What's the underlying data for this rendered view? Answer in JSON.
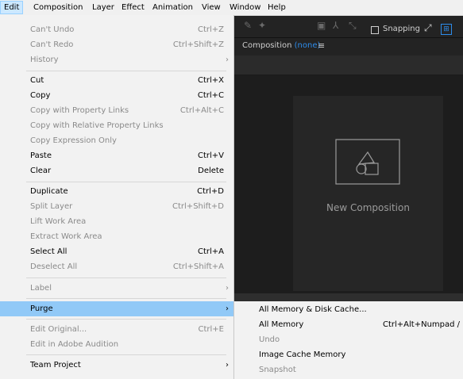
{
  "menubar": {
    "items": [
      "Edit",
      "Composition",
      "Layer",
      "Effect",
      "Animation",
      "View",
      "Window",
      "Help"
    ]
  },
  "edit_menu": {
    "undo": {
      "label": "Can't Undo",
      "shortcut": "Ctrl+Z"
    },
    "redo": {
      "label": "Can't Redo",
      "shortcut": "Ctrl+Shift+Z"
    },
    "history": {
      "label": "History"
    },
    "cut": {
      "label": "Cut",
      "shortcut": "Ctrl+X"
    },
    "copy": {
      "label": "Copy",
      "shortcut": "Ctrl+C"
    },
    "copy_prop_links": {
      "label": "Copy with Property Links",
      "shortcut": "Ctrl+Alt+C"
    },
    "copy_rel_prop_links": {
      "label": "Copy with Relative Property Links"
    },
    "copy_expr": {
      "label": "Copy Expression Only"
    },
    "paste": {
      "label": "Paste",
      "shortcut": "Ctrl+V"
    },
    "clear": {
      "label": "Clear",
      "shortcut": "Delete"
    },
    "duplicate": {
      "label": "Duplicate",
      "shortcut": "Ctrl+D"
    },
    "split_layer": {
      "label": "Split Layer",
      "shortcut": "Ctrl+Shift+D"
    },
    "lift_work_area": {
      "label": "Lift Work Area"
    },
    "extract_work_area": {
      "label": "Extract Work Area"
    },
    "select_all": {
      "label": "Select All",
      "shortcut": "Ctrl+A"
    },
    "deselect_all": {
      "label": "Deselect All",
      "shortcut": "Ctrl+Shift+A"
    },
    "label": {
      "label": "Label"
    },
    "purge": {
      "label": "Purge"
    },
    "edit_original": {
      "label": "Edit Original...",
      "shortcut": "Ctrl+E"
    },
    "edit_audition": {
      "label": "Edit in Adobe Audition"
    },
    "team_project": {
      "label": "Team Project"
    }
  },
  "purge_submenu": {
    "all_memory_disk": {
      "label": "All Memory & Disk Cache..."
    },
    "all_memory": {
      "label": "All Memory",
      "shortcut": "Ctrl+Alt+Numpad /"
    },
    "undo": {
      "label": "Undo"
    },
    "image_cache": {
      "label": "Image Cache Memory"
    },
    "snapshot": {
      "label": "Snapshot"
    }
  },
  "toolbar": {
    "snapping_label": "Snapping"
  },
  "composition_panel": {
    "title_prefix": "Composition",
    "title_name": "(none)",
    "new_composition_label": "New Composition"
  },
  "icons": {
    "submenu_arrow": "chevron-right-icon",
    "panel_menu": "hamburger-icon",
    "new_comp": "new-composition-icon"
  },
  "colors": {
    "menu_bg": "#f2f2f2",
    "highlight": "#91c9f7",
    "accent_blue": "#2d8ceb",
    "app_bg": "#232323"
  }
}
